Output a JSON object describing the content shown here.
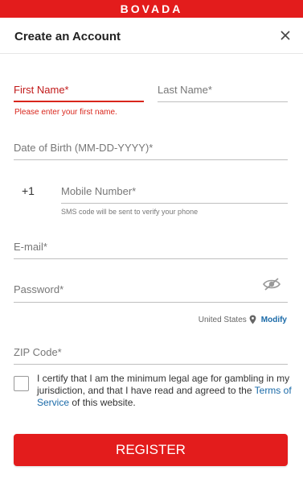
{
  "brand": {
    "logo_text": "BOVADA",
    "color": "#e31c1c"
  },
  "header": {
    "title": "Create an Account",
    "close_icon": "close-icon"
  },
  "form": {
    "first_name": {
      "label": "First Name*",
      "error": "Please enter your first name."
    },
    "last_name": {
      "label": "Last Name*"
    },
    "dob": {
      "label": "Date of Birth (MM-DD-YYYY)*"
    },
    "phone": {
      "country_code": "+1",
      "label": "Mobile Number*",
      "hint": "SMS code will be sent to verify your phone"
    },
    "email": {
      "label": "E-mail*"
    },
    "password": {
      "label": "Password*",
      "toggle_icon": "eye-slash-icon"
    },
    "country": {
      "name": "United States",
      "icon": "location-pin-icon",
      "modify_label": "Modify"
    },
    "zip": {
      "label": "ZIP Code*"
    },
    "certify": {
      "text_before": "I certify that I am the minimum legal age for gambling in my jurisdiction, and that I have read and agreed to the ",
      "link_text": "Terms of Service",
      "text_after": " of this website.",
      "checked": false
    },
    "register_label": "REGISTER"
  },
  "colors": {
    "accent": "#e31c1c",
    "link": "#1a6aa8",
    "error": "#d9261c"
  }
}
